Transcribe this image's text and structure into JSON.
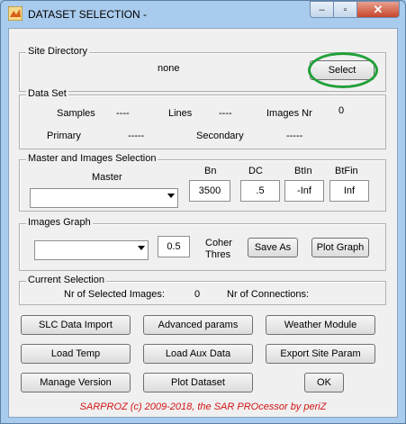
{
  "window": {
    "title": "DATASET SELECTION -",
    "close_glyph": "✕",
    "minimize_glyph": "–",
    "maximize_glyph": "▫"
  },
  "site_directory": {
    "label": "Site Directory",
    "value": "none",
    "select_button": "Select"
  },
  "data_set": {
    "label": "Data Set",
    "samples_label": "Samples",
    "samples_value": "----",
    "lines_label": "Lines",
    "lines_value": "----",
    "images_nr_label": "Images Nr",
    "images_nr_value": "0",
    "primary_label": "Primary",
    "primary_value": "-----",
    "secondary_label": "Secondary",
    "secondary_value": "-----"
  },
  "master_selection": {
    "label": "Master and Images Selection",
    "master_label": "Master",
    "master_value": "",
    "bn_label": "Bn",
    "bn_value": "3500",
    "dc_label": "DC",
    "dc_value": ".5",
    "btin_label": "BtIn",
    "btin_value": "-Inf",
    "btfin_label": "BtFin",
    "btfin_value": "Inf"
  },
  "images_graph": {
    "label": "Images Graph",
    "dropdown_value": "",
    "coher_value": "0.5",
    "coher_label": "Coher",
    "thres_label": "Thres",
    "save_as_button": "Save As",
    "plot_graph_button": "Plot Graph"
  },
  "current_selection": {
    "label": "Current Selection",
    "selected_images_label": "Nr of Selected Images:",
    "selected_images_value": "0",
    "connections_label": "Nr of Connections:"
  },
  "buttons": {
    "slc_import": "SLC Data Import",
    "advanced_params": "Advanced params",
    "weather_module": "Weather Module",
    "load_temp": "Load Temp",
    "load_aux": "Load Aux Data",
    "export_site": "Export Site Param",
    "manage_version": "Manage Version",
    "plot_dataset": "Plot Dataset",
    "ok": "OK"
  },
  "footer": "SARPROZ (c) 2009-2018, the SAR PROcessor by periZ",
  "colors": {
    "highlight": "#22a039",
    "footer_text": "#d21414"
  }
}
